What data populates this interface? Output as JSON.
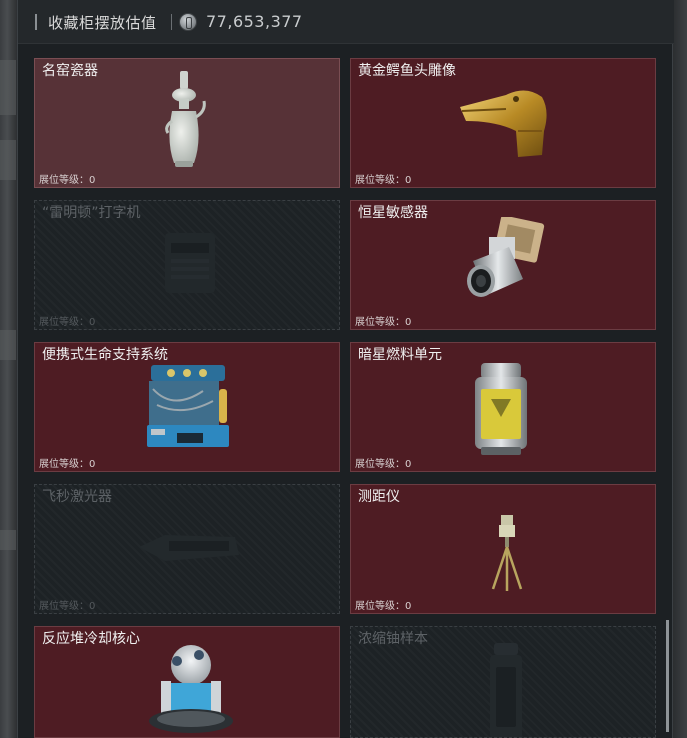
{
  "header": {
    "title": "收藏柜摆放估值",
    "value": "77,653,377",
    "icon": "coin-icon"
  },
  "cards": [
    {
      "name": "名窑瓷器",
      "level": "展位等级：0",
      "state": "owned",
      "icon": "porcelain-vase-icon"
    },
    {
      "name": "黄金鳄鱼头雕像",
      "level": "展位等级：0",
      "state": "owned",
      "icon": "golden-crocodile-head-icon"
    },
    {
      "name": "“雷明顿”打字机",
      "level": "展位等级：0",
      "state": "locked",
      "icon": "typewriter-icon"
    },
    {
      "name": "恒星敏感器",
      "level": "展位等级：0",
      "state": "owned",
      "icon": "star-sensor-icon"
    },
    {
      "name": "便携式生命支持系统",
      "level": "展位等级：0",
      "state": "owned",
      "icon": "life-support-system-icon"
    },
    {
      "name": "暗星燃料单元",
      "level": "展位等级：0",
      "state": "owned",
      "icon": "fuel-cell-icon"
    },
    {
      "name": "飞秒激光器",
      "level": "展位等级：0",
      "state": "locked",
      "icon": "femtosecond-laser-icon"
    },
    {
      "name": "测距仪",
      "level": "展位等级：0",
      "state": "owned",
      "icon": "rangefinder-icon"
    },
    {
      "name": "反应堆冷却核心",
      "level": "",
      "state": "owned",
      "icon": "reactor-core-icon"
    },
    {
      "name": "浓缩铀样本",
      "level": "",
      "state": "locked",
      "icon": "uranium-sample-icon"
    }
  ],
  "colors": {
    "owned_card": "#4e1c23",
    "locked_card": "#1d2225",
    "panel": "#1c2023"
  }
}
